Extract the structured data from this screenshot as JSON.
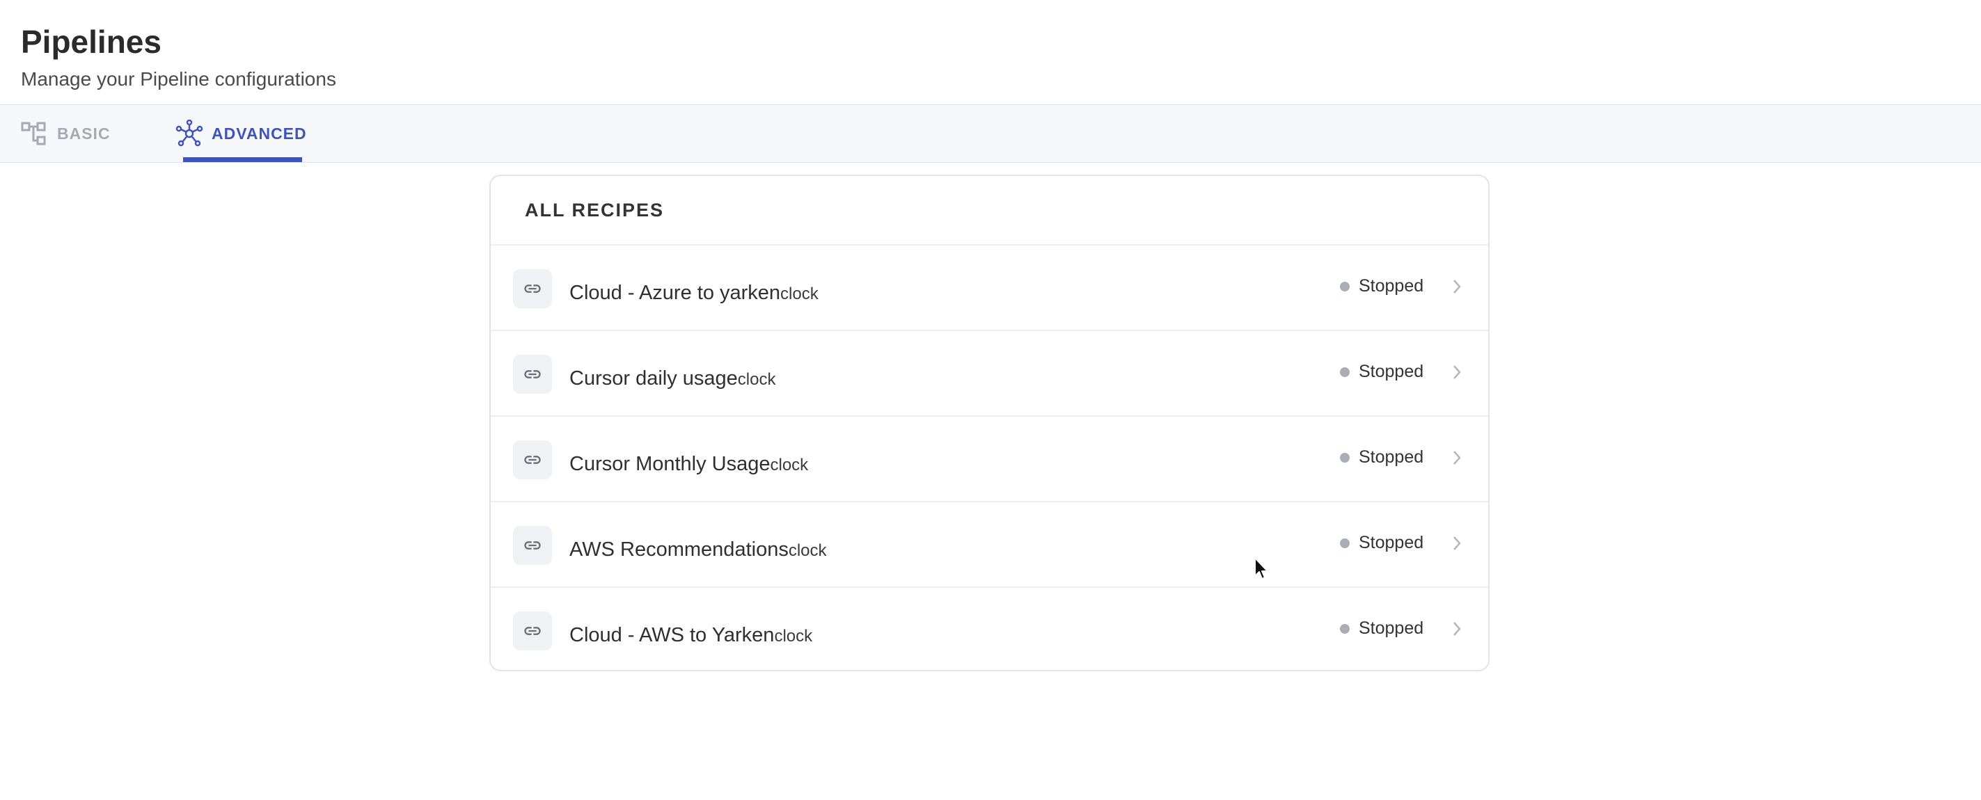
{
  "header": {
    "title": "Pipelines",
    "subtitle": "Manage your Pipeline configurations"
  },
  "tabs": [
    {
      "label": "BASIC",
      "icon": "hierarchy-icon",
      "active": false
    },
    {
      "label": "ADVANCED",
      "icon": "network-icon",
      "active": true
    }
  ],
  "recipes": {
    "title": "ALL RECIPES",
    "items": [
      {
        "name": "Cloud - Azure to yarken",
        "suffix": "clock",
        "status": "Stopped",
        "icon": "link-icon"
      },
      {
        "name": "Cursor daily usage",
        "suffix": "clock",
        "status": "Stopped",
        "icon": "link-icon"
      },
      {
        "name": "Cursor Monthly Usage",
        "suffix": "clock",
        "status": "Stopped",
        "icon": "link-icon"
      },
      {
        "name": "AWS Recommendations",
        "suffix": "clock",
        "status": "Stopped",
        "icon": "link-icon"
      },
      {
        "name": "Cloud - AWS to Yarken",
        "suffix": "clock",
        "status": "Stopped",
        "icon": "link-icon"
      }
    ]
  },
  "colors": {
    "accent": "#3d55b8",
    "status_stopped": "#a9adb5",
    "tab_inactive": "#a6a9b0"
  }
}
